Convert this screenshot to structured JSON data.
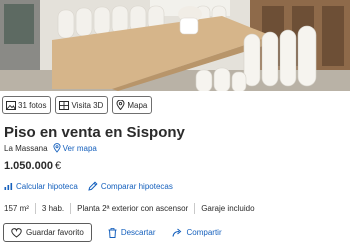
{
  "media": {
    "photos_label": "31 fotos",
    "tour_label": "Visita 3D",
    "map_label": "Mapa"
  },
  "listing": {
    "title": "Piso en venta en Sispony",
    "location": "La Massana",
    "see_map_label": "Ver mapa",
    "price": "1.050.000",
    "currency": "€"
  },
  "links": {
    "mortgage_calc": "Calcular hipoteca",
    "compare_mortgages": "Comparar hipotecas"
  },
  "features": [
    "157 m²",
    "3 hab.",
    "Planta 2ª exterior con ascensor",
    "Garaje incluido"
  ],
  "actions": {
    "save_favorite": "Guardar favorito",
    "discard": "Descartar",
    "share": "Compartir"
  },
  "colors": {
    "link_blue": "#1560bd",
    "text_dark": "#2b2b2b"
  }
}
